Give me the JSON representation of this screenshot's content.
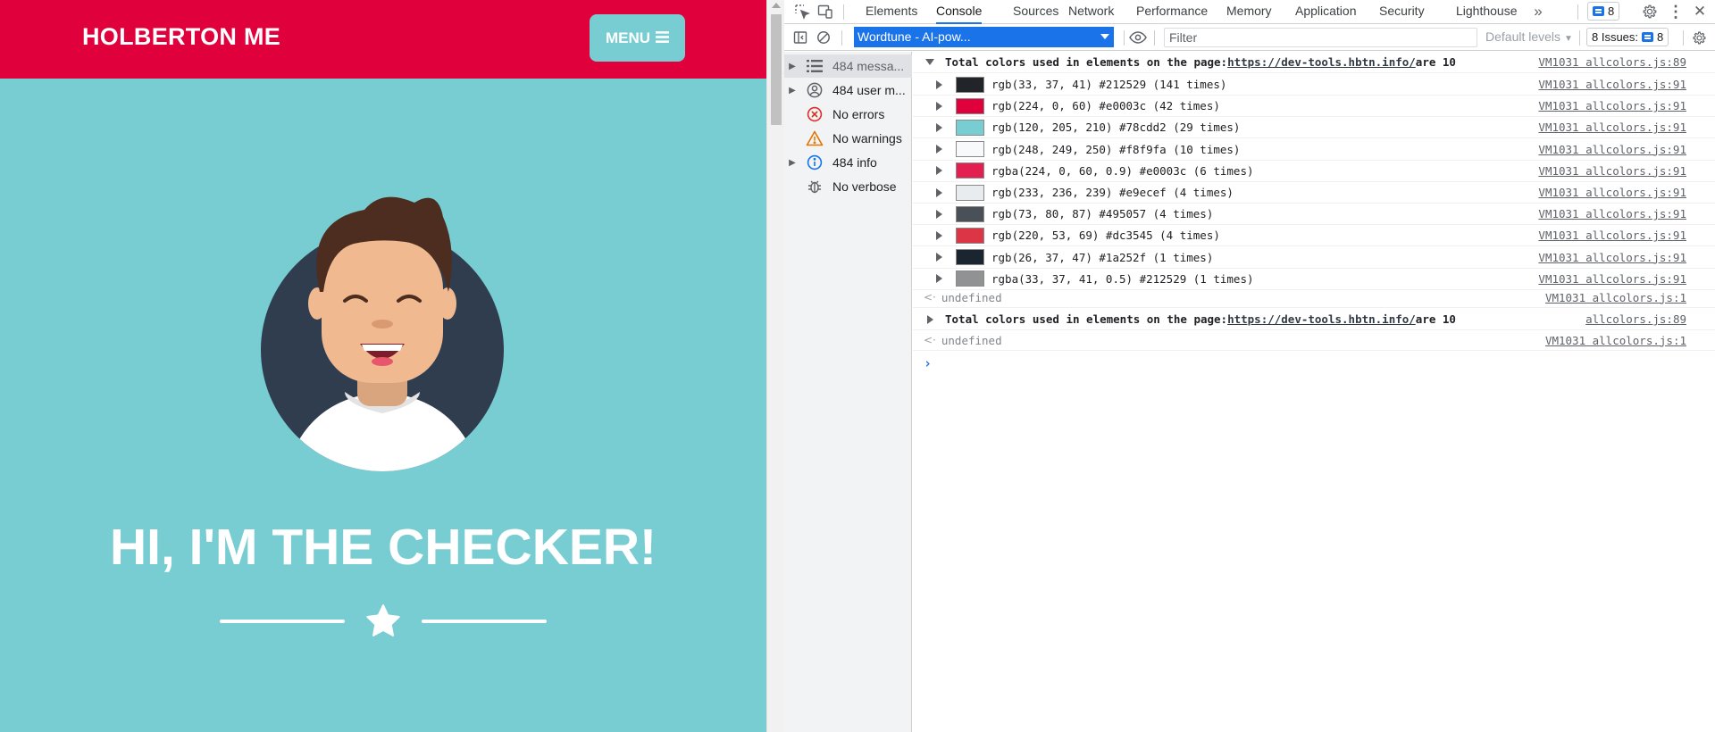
{
  "site": {
    "brand": "HOLBERTON ME",
    "menu_label": "MENU",
    "headline": "HI, I'M THE CHECKER!",
    "colors": {
      "nav": "#e0003c",
      "background": "#78cdd2",
      "avatar_circle": "#2f3d4f"
    }
  },
  "devtools": {
    "tabs": [
      "Elements",
      "Console",
      "Sources",
      "Network",
      "Performance",
      "Memory",
      "Application",
      "Security",
      "Lighthouse"
    ],
    "active_tab": "Console",
    "issues_count": "8",
    "context": "Wordtune - AI-pow...",
    "filter_placeholder": "Filter",
    "levels_label": "Default levels",
    "issues_label": "8 Issues:",
    "issues_small_count": "8",
    "sidebar": [
      {
        "label": "484 messa...",
        "icon": "list-icon",
        "expandable": true
      },
      {
        "label": "484 user m...",
        "icon": "user-icon",
        "expandable": true
      },
      {
        "label": "No errors",
        "icon": "error-icon",
        "expandable": false
      },
      {
        "label": "No warnings",
        "icon": "warning-icon",
        "expandable": false
      },
      {
        "label": "484 info",
        "icon": "info-icon",
        "expandable": true
      },
      {
        "label": "No verbose",
        "icon": "bug-icon",
        "expandable": false
      }
    ],
    "console": {
      "group1": {
        "prefix": "Total colors used in elements on the page: ",
        "url": "https://dev-tools.hbtn.info/",
        "suffix": " are 10",
        "source": "VM1031 allcolors.js:89"
      },
      "colors": [
        {
          "text": "rgb(33, 37, 41) #212529 (141 times)",
          "swatch": "#212529",
          "source": "VM1031 allcolors.js:91"
        },
        {
          "text": "rgb(224, 0, 60) #e0003c (42 times)",
          "swatch": "#e0003c",
          "source": "VM1031 allcolors.js:91"
        },
        {
          "text": "rgb(120, 205, 210) #78cdd2 (29 times)",
          "swatch": "#78cdd2",
          "source": "VM1031 allcolors.js:91"
        },
        {
          "text": "rgb(248, 249, 250) #f8f9fa (10 times)",
          "swatch": "#f8f9fa",
          "source": "VM1031 allcolors.js:91"
        },
        {
          "text": "rgba(224, 0, 60, 0.9) #e0003c (6 times)",
          "swatch": "#e21f4f",
          "source": "VM1031 allcolors.js:91"
        },
        {
          "text": "rgb(233, 236, 239) #e9ecef (4 times)",
          "swatch": "#e9ecef",
          "source": "VM1031 allcolors.js:91"
        },
        {
          "text": "rgb(73, 80, 87) #495057 (4 times)",
          "swatch": "#495057",
          "source": "VM1031 allcolors.js:91"
        },
        {
          "text": "rgb(220, 53, 69) #dc3545 (4 times)",
          "swatch": "#dc3545",
          "source": "VM1031 allcolors.js:91"
        },
        {
          "text": "rgb(26, 37, 47) #1a252f (1 times)",
          "swatch": "#1a252f",
          "source": "VM1031 allcolors.js:91"
        },
        {
          "text": "rgba(33, 37, 41, 0.5) #212529 (1 times)",
          "swatch": "#909294",
          "source": "VM1031 allcolors.js:91"
        }
      ],
      "undefined1": {
        "text": "undefined",
        "source": "VM1031 allcolors.js:1"
      },
      "group2": {
        "prefix": "Total colors used in elements on the page: ",
        "url": "https://dev-tools.hbtn.info/",
        "suffix": " are 10",
        "source": "allcolors.js:89"
      },
      "undefined2": {
        "text": "undefined",
        "source": "VM1031 allcolors.js:1"
      }
    }
  }
}
